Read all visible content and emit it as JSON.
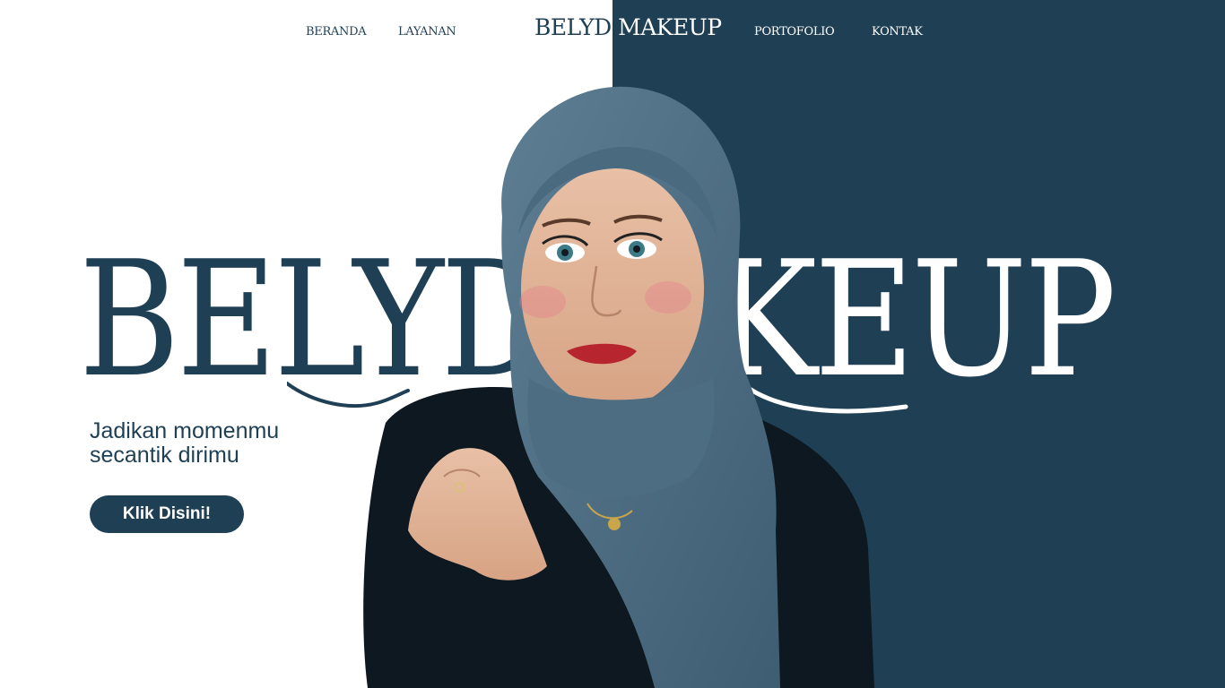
{
  "nav": {
    "items": [
      {
        "label": "BERANDA"
      },
      {
        "label": "LAYANAN"
      },
      {
        "label": "PORTOFOLIO"
      },
      {
        "label": "KONTAK"
      }
    ]
  },
  "brand": {
    "part1": "BELYD",
    "part2": " MAKEUP"
  },
  "hero": {
    "word_left": "BELYD",
    "word_right": "AKEUP",
    "tagline_line1": "Jadikan momenmu",
    "tagline_line2": "secantik dirimu",
    "cta_label": "Klik Disini!"
  },
  "colors": {
    "primary": "#1f3f55",
    "background": "#ffffff",
    "scarf": "#4c6b80"
  },
  "image": {
    "description_name": "model-portrait"
  }
}
